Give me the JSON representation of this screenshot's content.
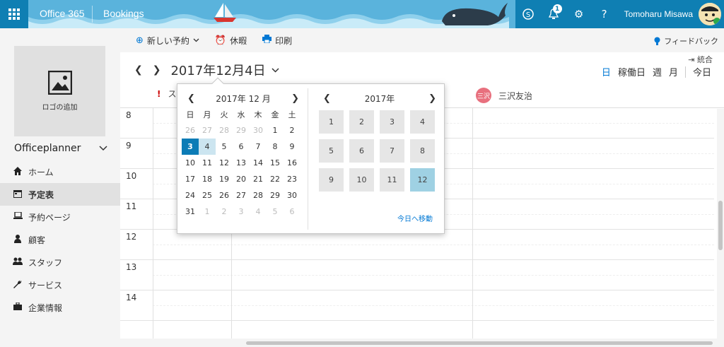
{
  "topbar": {
    "app": "Office 365",
    "product": "Bookings",
    "notifications": "1",
    "user": "Tomoharu Misawa"
  },
  "commands": {
    "new": "新しい予約",
    "timeoff": "休暇",
    "print": "印刷",
    "feedback": "フィードバック"
  },
  "sidebar": {
    "logo_label": "ロゴの追加",
    "business": "Officeplanner",
    "items": [
      {
        "label": "ホーム",
        "icon": "home-icon"
      },
      {
        "label": "予定表",
        "icon": "calendar-icon"
      },
      {
        "label": "予約ページ",
        "icon": "laptop-icon"
      },
      {
        "label": "顧客",
        "icon": "customer-icon"
      },
      {
        "label": "スタッフ",
        "icon": "staff-icon"
      },
      {
        "label": "サービス",
        "icon": "wrench-icon"
      },
      {
        "label": "企業情報",
        "icon": "briefcase-icon"
      }
    ]
  },
  "calendar": {
    "date": "2017年12月4日",
    "merge": "統合",
    "views": {
      "day": "日",
      "workweek": "稼働日",
      "week": "週",
      "month": "月",
      "today": "今日"
    },
    "staff": [
      {
        "name": "ス"
      },
      {
        "initials": "三沢",
        "name": "三沢友治"
      }
    ],
    "hours": [
      "8",
      "9",
      "10",
      "11",
      "12",
      "13",
      "14"
    ]
  },
  "picker": {
    "month_title": "2017年 12 月",
    "year_title": "2017年",
    "dow": [
      "日",
      "月",
      "火",
      "水",
      "木",
      "金",
      "土"
    ],
    "weeks": [
      [
        "26",
        "27",
        "28",
        "29",
        "30",
        "1",
        "2"
      ],
      [
        "3",
        "4",
        "5",
        "6",
        "7",
        "8",
        "9"
      ],
      [
        "10",
        "11",
        "12",
        "13",
        "14",
        "15",
        "16"
      ],
      [
        "17",
        "18",
        "19",
        "20",
        "21",
        "22",
        "23"
      ],
      [
        "24",
        "25",
        "26",
        "27",
        "28",
        "29",
        "30"
      ],
      [
        "31",
        "1",
        "2",
        "3",
        "4",
        "5",
        "6"
      ]
    ],
    "months": [
      "1",
      "2",
      "3",
      "4",
      "5",
      "6",
      "7",
      "8",
      "9",
      "10",
      "11",
      "12"
    ],
    "goto_today": "今日へ移動"
  },
  "colors": {
    "accent": "#0078d4",
    "today": "#0c7cb6",
    "current_month": "#9fd1e3"
  }
}
